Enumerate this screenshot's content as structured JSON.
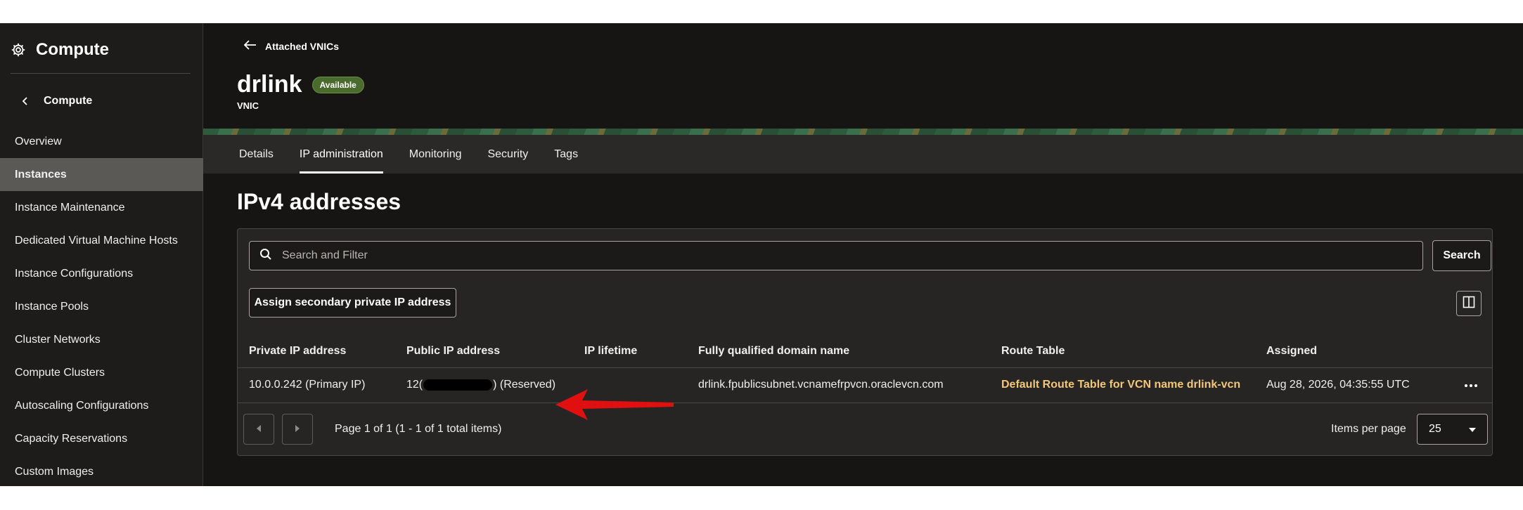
{
  "sidebar": {
    "title": "Compute",
    "back_label": "Compute",
    "items": [
      {
        "label": "Overview",
        "active": false
      },
      {
        "label": "Instances",
        "active": true
      },
      {
        "label": "Instance Maintenance",
        "active": false
      },
      {
        "label": "Dedicated Virtual Machine Hosts",
        "active": false
      },
      {
        "label": "Instance Configurations",
        "active": false
      },
      {
        "label": "Instance Pools",
        "active": false
      },
      {
        "label": "Cluster Networks",
        "active": false
      },
      {
        "label": "Compute Clusters",
        "active": false
      },
      {
        "label": "Autoscaling Configurations",
        "active": false
      },
      {
        "label": "Capacity Reservations",
        "active": false
      },
      {
        "label": "Custom Images",
        "active": false
      }
    ]
  },
  "header": {
    "back_label": "Attached VNICs",
    "title": "drlink",
    "status": "Available",
    "subtitle": "VNIC"
  },
  "tabs": [
    {
      "label": "Details",
      "active": false
    },
    {
      "label": "IP administration",
      "active": true
    },
    {
      "label": "Monitoring",
      "active": false
    },
    {
      "label": "Security",
      "active": false
    },
    {
      "label": "Tags",
      "active": false
    }
  ],
  "section": {
    "title": "IPv4 addresses",
    "search_placeholder": "Search and Filter",
    "search_button": "Search",
    "assign_button": "Assign secondary private IP address"
  },
  "table": {
    "columns": [
      "Private IP address",
      "Public IP address",
      "IP lifetime",
      "Fully qualified domain name",
      "Route Table",
      "Assigned"
    ],
    "rows": [
      {
        "private_ip": "10.0.0.242 (Primary IP)",
        "public_ip_prefix": "12(",
        "public_ip_suffix": ") (Reserved)",
        "ip_lifetime": "",
        "fqdn": "drlink.fpublicsubnet.vcnamefrpvcn.oraclevcn.com",
        "route_table": "Default Route Table for VCN name drlink-vcn",
        "assigned": "Aug 28, 2026, 04:35:55 UTC"
      }
    ]
  },
  "pagination": {
    "summary": "Page 1 of 1 (1 - 1 of 1 total items)",
    "items_per_page_label": "Items per page",
    "items_per_page": "25"
  },
  "colors": {
    "background": "#161513",
    "sidebar": "#1d1c1a",
    "active_item": "#5b5955",
    "badge": "#4a6b2b",
    "link": "#f3c779",
    "annotation_arrow": "#e01010"
  }
}
